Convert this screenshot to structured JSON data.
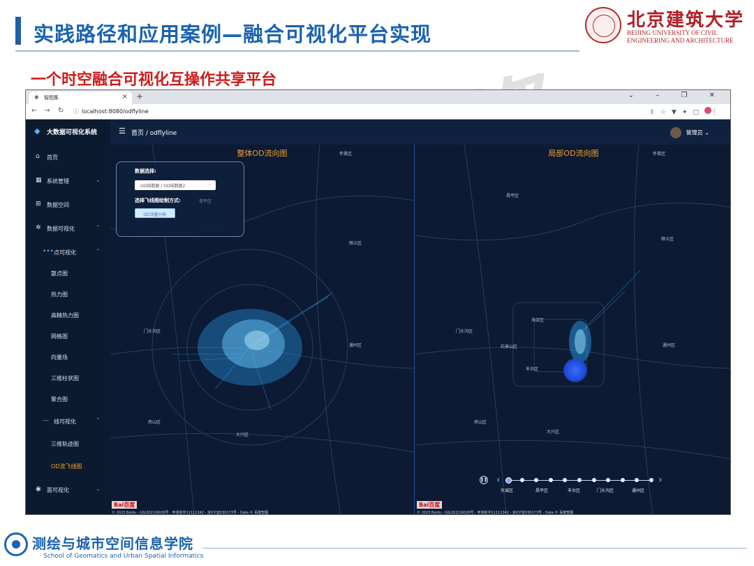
{
  "slide": {
    "title": "实践路径和应用案例—融合可视化平台实现",
    "subtitle": "一个时空融合可视化互操作共享平台",
    "university_cn": "北京建筑大学",
    "university_en_line1": "BEIJING UNIVERSITY OF CIVIL",
    "university_en_line2": "ENGINEERING AND ARCHITECTURE",
    "watermark": "资",
    "footer_cn": "测绘与城市空间信息学院",
    "footer_en": "School of Geomatics and Urban Spatial Informatics"
  },
  "browser": {
    "tab_title": "智图集",
    "url": "localhost:8080/odflyline",
    "new_tab": "+",
    "tab_close": "×",
    "win_controls": "⌄ – ❐ ✕"
  },
  "app": {
    "brand": "大数据可视化系统",
    "breadcrumb": "首页  /  odflyline",
    "user": "管理员",
    "menu": [
      {
        "label": "首页",
        "icon": "⌂"
      },
      {
        "label": "系统管理",
        "icon": "▦"
      },
      {
        "label": "数据空间",
        "icon": "⊞"
      },
      {
        "label": "数据可视化",
        "icon": "✲"
      },
      {
        "label": "点可视化",
        "icon": "•••"
      },
      {
        "label": "散点图"
      },
      {
        "label": "热力图"
      },
      {
        "label": "高精热力图"
      },
      {
        "label": "网格图"
      },
      {
        "label": "向量场"
      },
      {
        "label": "三维柱状图"
      },
      {
        "label": "聚合图"
      },
      {
        "label": "线可视化",
        "icon": "—"
      },
      {
        "label": "三维轨迹图"
      },
      {
        "label": "OD流飞线图"
      },
      {
        "label": "面可视化",
        "icon": "◉"
      }
    ]
  },
  "left_map": {
    "title": "整体OD流向图",
    "panel": {
      "data_label": "数据选择:",
      "select_value": "OD线数据 / OD线数据2",
      "render_label": "选择飞线图绘制方式:",
      "render_hint": "单平区",
      "button": "OD流量分析"
    },
    "places": [
      "怀柔区",
      "顺义区",
      "门头沟区",
      "通州区",
      "房山区",
      "大兴区"
    ],
    "baidu": "Bai百度",
    "copyright": "© 2023 Baidu - GS(2021)6026号 - 甲测资字11111342 - 京ICP证030173号 - Data © 百度智图"
  },
  "right_map": {
    "title": "局部OD流向图",
    "places": [
      "怀柔区",
      "昌平区",
      "顺义区",
      "海淀区",
      "门头沟区",
      "石景山区",
      "通州区",
      "丰台区",
      "房山区",
      "大兴区"
    ],
    "baidu": "Bai百度",
    "copyright": "© 2023 Baidu - GS(2021)6026号 - 甲测资字11111342 - 京ICP证030173号 - Data © 百度智图",
    "timeline": [
      "东城区",
      "昌平区",
      "丰台区",
      "门头沟区",
      "通州区"
    ],
    "timeline_steps": 11
  },
  "colors": {
    "title_blue": "#1a63b0",
    "subtitle_red": "#d11b1b",
    "map_bg": "#0c1a33",
    "flow_cyan": "#3fb8ff",
    "active_menu": "#f5a623"
  }
}
